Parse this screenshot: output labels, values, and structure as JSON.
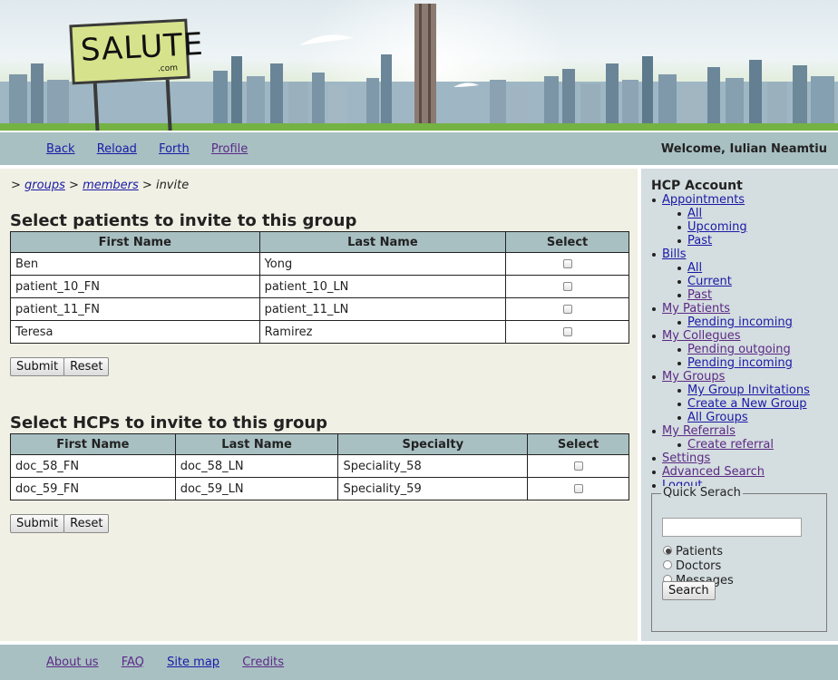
{
  "banner": {
    "logo_text": "SALUTE",
    "logo_subtext": ".com"
  },
  "nav": {
    "links": [
      {
        "label": "Back"
      },
      {
        "label": "Reload"
      },
      {
        "label": "Forth"
      },
      {
        "label": "Profile"
      }
    ],
    "welcome": "Welcome, Iulian Neamtiu"
  },
  "breadcrumb": {
    "prefix": ">",
    "groups": "groups",
    "separator": ">",
    "members": "members",
    "current": "invite"
  },
  "patients_section": {
    "title": "Select patients to invite to this group",
    "headers": [
      "First Name",
      "Last Name",
      "Select"
    ],
    "rows": [
      {
        "first": "Ben",
        "last": "Yong",
        "checked": false
      },
      {
        "first": "patient_10_FN",
        "last": "patient_10_LN",
        "checked": false
      },
      {
        "first": "patient_11_FN",
        "last": "patient_11_LN",
        "checked": false
      },
      {
        "first": "Teresa",
        "last": "Ramirez",
        "checked": false
      }
    ],
    "submit_label": "Submit",
    "reset_label": "Reset"
  },
  "hcps_section": {
    "title": "Select HCPs to invite to this group",
    "headers": [
      "First Name",
      "Last Name",
      "Specialty",
      "Select"
    ],
    "rows": [
      {
        "first": "doc_58_FN",
        "last": "doc_58_LN",
        "specialty": "Speciality_58",
        "checked": false
      },
      {
        "first": "doc_59_FN",
        "last": "doc_59_LN",
        "specialty": "Speciality_59",
        "checked": false
      }
    ],
    "submit_label": "Submit",
    "reset_label": "Reset"
  },
  "sidebar": {
    "title": "HCP Account",
    "menu": [
      {
        "label": "Appointments",
        "children": [
          "All",
          "Upcoming",
          "Past"
        ]
      },
      {
        "label": "Bills",
        "children": [
          "All",
          "Current",
          "Past"
        ]
      },
      {
        "label": "My Patients",
        "children": [
          "Pending incoming"
        ]
      },
      {
        "label": "My Collegues",
        "children": [
          "Pending outgoing",
          "Pending incoming"
        ]
      },
      {
        "label": "My Groups",
        "children": [
          "My Group Invitations",
          "Create a New Group",
          "All Groups"
        ]
      },
      {
        "label": "My Referrals",
        "children": [
          "Create referral"
        ]
      },
      {
        "label": "Settings",
        "children": []
      },
      {
        "label": "Advanced Search",
        "children": []
      },
      {
        "label": "Logout",
        "children": []
      }
    ],
    "quick_search": {
      "legend": "Quick Serach",
      "input_value": "",
      "options": [
        {
          "label": "Patients",
          "selected": true
        },
        {
          "label": "Doctors",
          "selected": false
        },
        {
          "label": "Messages",
          "selected": false
        }
      ],
      "search_label": "Search"
    }
  },
  "footer": {
    "links": [
      {
        "label": "About us"
      },
      {
        "label": "FAQ"
      },
      {
        "label": "Site map"
      },
      {
        "label": "Credits"
      }
    ]
  }
}
